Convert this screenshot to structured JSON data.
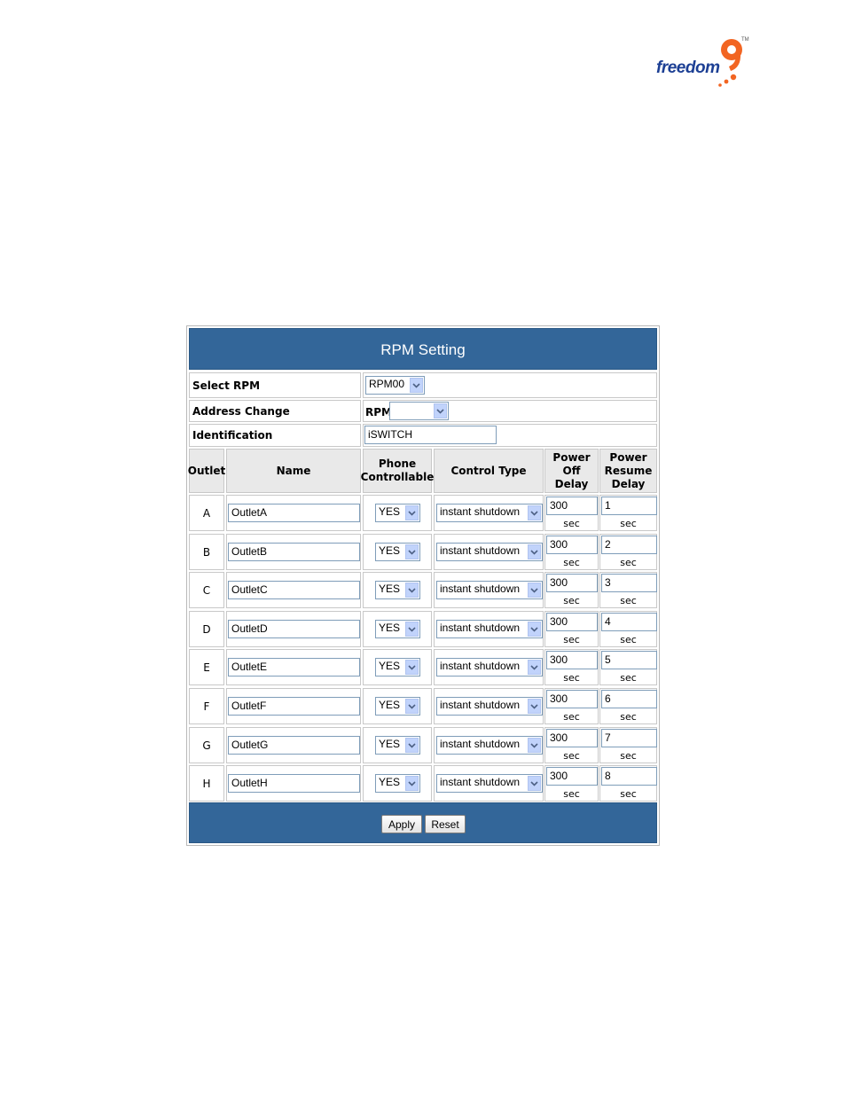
{
  "brand": {
    "logo_text": "freedom",
    "logo_mark": "9",
    "tm": "TM",
    "colors": {
      "blue": "#1c3f94",
      "orange": "#f26522"
    }
  },
  "panel": {
    "title": "RPM Setting",
    "header_color": "#336699",
    "select_rpm": {
      "label": "Select RPM",
      "value": "RPM00"
    },
    "address_change": {
      "label": "Address Change",
      "prefix": "RPM",
      "value": ""
    },
    "identification": {
      "label": "Identification",
      "value": "iSWITCH"
    },
    "columns": {
      "outlet": "Outlet",
      "name": "Name",
      "phone_controllable": [
        "Phone",
        "Controllable"
      ],
      "control_type": "Control Type",
      "power_off_delay": [
        "Power",
        "Off",
        "Delay"
      ],
      "power_resume_delay": [
        "Power",
        "Resume",
        "Delay"
      ]
    },
    "unit": "sec",
    "rows": [
      {
        "outlet": "A",
        "name": "OutletA",
        "phone": "YES",
        "control": "instant shutdown",
        "off_delay": "300",
        "resume_delay": "1"
      },
      {
        "outlet": "B",
        "name": "OutletB",
        "phone": "YES",
        "control": "instant shutdown",
        "off_delay": "300",
        "resume_delay": "2"
      },
      {
        "outlet": "C",
        "name": "OutletC",
        "phone": "YES",
        "control": "instant shutdown",
        "off_delay": "300",
        "resume_delay": "3"
      },
      {
        "outlet": "D",
        "name": "OutletD",
        "phone": "YES",
        "control": "instant shutdown",
        "off_delay": "300",
        "resume_delay": "4"
      },
      {
        "outlet": "E",
        "name": "OutletE",
        "phone": "YES",
        "control": "instant shutdown",
        "off_delay": "300",
        "resume_delay": "5"
      },
      {
        "outlet": "F",
        "name": "OutletF",
        "phone": "YES",
        "control": "instant shutdown",
        "off_delay": "300",
        "resume_delay": "6"
      },
      {
        "outlet": "G",
        "name": "OutletG",
        "phone": "YES",
        "control": "instant shutdown",
        "off_delay": "300",
        "resume_delay": "7"
      },
      {
        "outlet": "H",
        "name": "OutletH",
        "phone": "YES",
        "control": "instant shutdown",
        "off_delay": "300",
        "resume_delay": "8"
      }
    ],
    "buttons": {
      "apply": "Apply",
      "reset": "Reset"
    }
  }
}
